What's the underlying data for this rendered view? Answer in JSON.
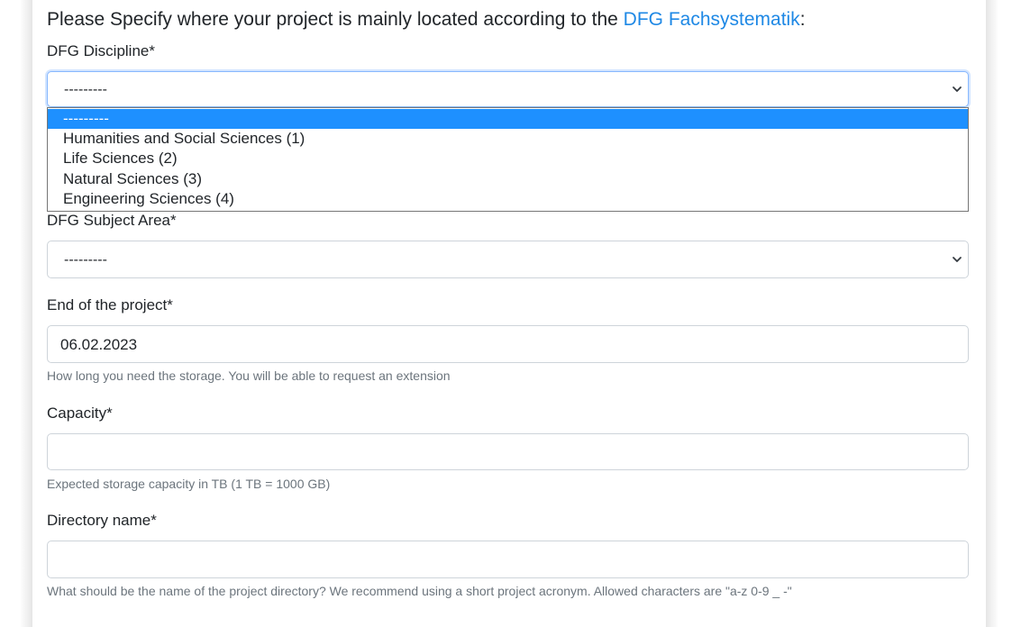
{
  "section": {
    "heading_prefix": "Please Specify where your project is mainly located according to the ",
    "heading_link": "DFG Fachsystematik",
    "heading_suffix": ":"
  },
  "discipline": {
    "label": "DFG Discipline*",
    "selected": "---------",
    "options": [
      "---------",
      "Humanities and Social Sciences (1)",
      "Life Sciences (2)",
      "Natural Sciences (3)",
      "Engineering Sciences (4)"
    ]
  },
  "subject_area": {
    "label": "DFG Subject Area*",
    "selected": "---------"
  },
  "end_of_project": {
    "label": "End of the project*",
    "value": "06.02.2023",
    "help": "How long you need the storage. You will be able to request an extension"
  },
  "capacity": {
    "label": "Capacity*",
    "value": "",
    "help": "Expected storage capacity in TB (1 TB = 1000 GB)"
  },
  "directory_name": {
    "label": "Directory name*",
    "value": "",
    "help": "What should be the name of the project directory? We recommend using a short project acronym. Allowed characters are \"a-z 0-9 _ -\""
  },
  "colors": {
    "link": "#1e88e5",
    "selected_option": "#1e90ff",
    "help_text": "#6c757d"
  }
}
